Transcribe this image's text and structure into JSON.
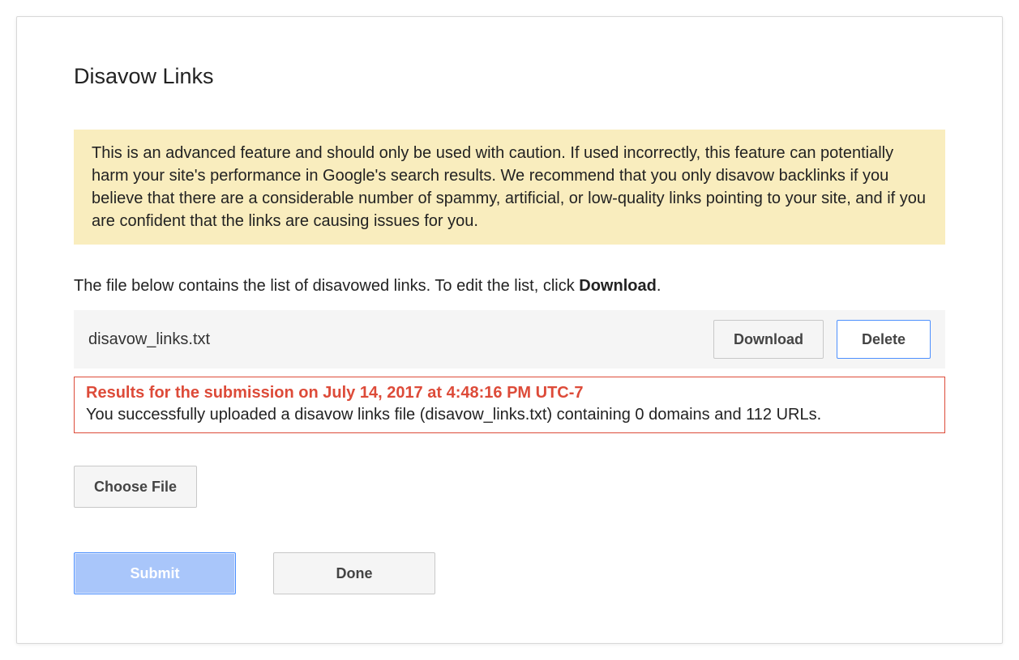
{
  "title": "Disavow Links",
  "warning": "This is an advanced feature and should only be used with caution. If used incorrectly, this feature can potentially harm your site's performance in Google's search results. We recommend that you only disavow backlinks if you believe that there are a considerable number of spammy, artificial, or low-quality links pointing to your site, and if you are confident that the links are causing issues for you.",
  "instruction_prefix": "The file below contains the list of disavowed links. To edit the list, click ",
  "instruction_bold": "Download",
  "instruction_suffix": ".",
  "file": {
    "name": "disavow_links.txt",
    "download_label": "Download",
    "delete_label": "Delete"
  },
  "result": {
    "header": "Results for the submission on July 14, 2017 at 4:48:16 PM UTC-7",
    "body": "You successfully uploaded a disavow links file (disavow_links.txt) containing 0 domains and 112 URLs."
  },
  "buttons": {
    "choose_file": "Choose File",
    "submit": "Submit",
    "done": "Done"
  }
}
